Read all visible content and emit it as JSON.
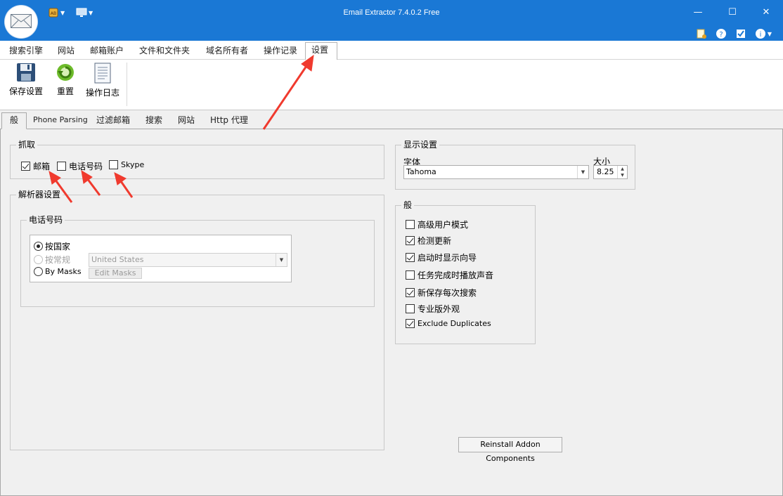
{
  "window": {
    "title": "Email Extractor 7.4.0.2 Free",
    "minimize_glyph": "—",
    "maximize_glyph": "☐",
    "close_glyph": "✕"
  },
  "qat": [
    "address-book-icon",
    "monitor-icon"
  ],
  "help_icons": [
    "notes-icon",
    "help-icon",
    "checklist-icon",
    "info-icon"
  ],
  "menu": {
    "tabs": [
      "搜索引擎",
      "网站",
      "邮箱账户",
      "文件和文件夹",
      "域名所有者",
      "操作记录",
      "设置"
    ],
    "active": "设置"
  },
  "ribbon": {
    "save_label": "保存设置",
    "reset_label": "重置",
    "log_label": "操作日志"
  },
  "subtabs": {
    "items": [
      "般",
      "Phone Parsing",
      "过滤邮箱",
      "搜索",
      "网站",
      "Http 代理"
    ],
    "active": "般"
  },
  "capture": {
    "title": "抓取",
    "email_label": "邮箱",
    "email_checked": true,
    "phone_label": "电话号码",
    "phone_checked": false,
    "skype_label": "Skype",
    "skype_checked": false
  },
  "parser": {
    "title": "解析器设置",
    "phone_group_title": "电话号码",
    "radio_country": "按国家",
    "radio_regular": "按常规",
    "radio_masks": "By Masks",
    "country_value": "United States",
    "edit_masks_label": "Edit Masks",
    "selected": "按国家"
  },
  "display": {
    "title": "显示设置",
    "font_label": "字体",
    "font_value": "Tahoma",
    "size_label": "大小",
    "size_value": "8.25"
  },
  "general": {
    "title": "般",
    "options": [
      {
        "label": "高级用户模式",
        "checked": false
      },
      {
        "label": "检测更新",
        "checked": true
      },
      {
        "label": "启动时显示向导",
        "checked": true
      },
      {
        "label": "任务完成时播放声音",
        "checked": false
      },
      {
        "label": "新保存每次搜索",
        "checked": true
      },
      {
        "label": "专业版外观",
        "checked": false
      },
      {
        "label": "Exclude Duplicates",
        "checked": true
      }
    ]
  },
  "reinstall_label": "Reinstall Addon Components",
  "colors": {
    "titlebar": "#1a78d5",
    "annotation_arrow": "#f03a2e"
  }
}
